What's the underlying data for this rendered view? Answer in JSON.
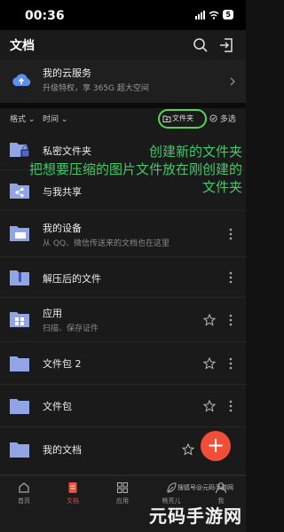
{
  "status": {
    "time": "00:36",
    "battery": "5"
  },
  "header": {
    "title": "文档"
  },
  "cloud": {
    "title": "我的云服务",
    "subtitle": "升级特权，享 365G 超大空间"
  },
  "sort": {
    "format": "格式",
    "time": "时间",
    "new_folder": "文件夹",
    "multi_select": "多选"
  },
  "rows": [
    {
      "title": "私密文件夹",
      "subtitle": ""
    },
    {
      "title": "与我共享",
      "subtitle": ""
    },
    {
      "title": "我的设备",
      "subtitle": "从 QQ、微信传送来的文档也在这里"
    },
    {
      "title": "解压后的文件",
      "subtitle": ""
    },
    {
      "title": "应用",
      "subtitle": "扫描、保存证件"
    },
    {
      "title": "文件包 2",
      "subtitle": ""
    },
    {
      "title": "文件包",
      "subtitle": ""
    },
    {
      "title": "我的文档",
      "subtitle": ""
    }
  ],
  "annotation": {
    "line1": "创建新的文件夹",
    "line2": "把想要压缩的图片文件放在刚创建的",
    "line3": "文件夹"
  },
  "fab": {
    "label": "+"
  },
  "nav": [
    {
      "label": "首页"
    },
    {
      "label": "文档"
    },
    {
      "label": "应用"
    },
    {
      "label": "畅亮儿"
    },
    {
      "label": "我"
    }
  ],
  "watermark": {
    "text": "元码手游网",
    "sub": "搜狐号@元码手游网"
  },
  "colors": {
    "accent": "#f04e37",
    "annotation": "#41c86a",
    "folder": "#8fa5e6",
    "cloud": "#5b8ff0"
  }
}
